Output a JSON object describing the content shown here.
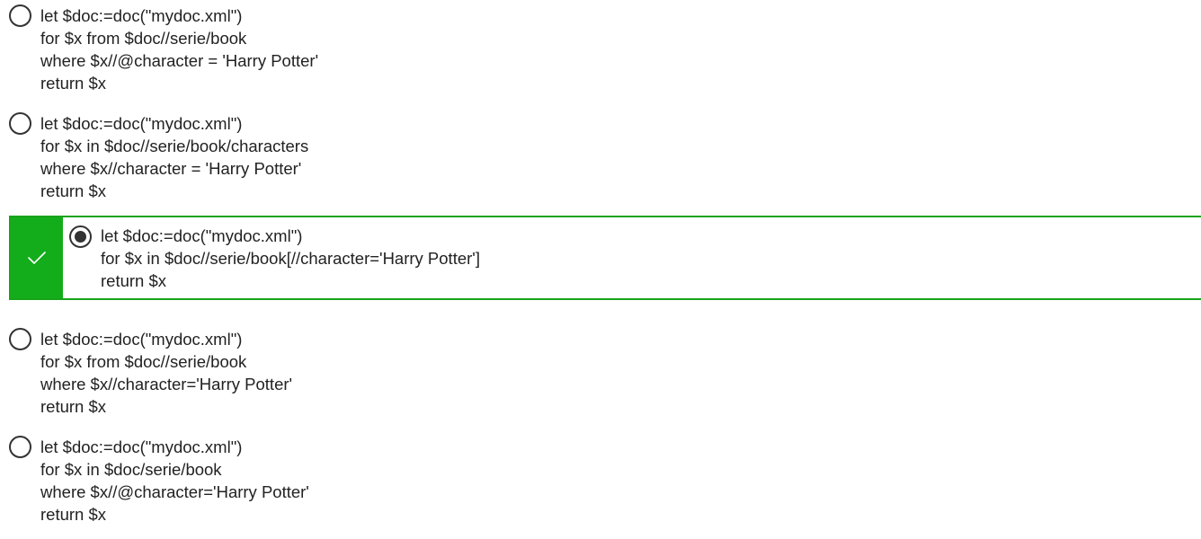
{
  "question": {
    "options": [
      {
        "lines": [
          "let $doc:=doc(\"mydoc.xml\")",
          "for $x from $doc//serie/book",
          "where $x//@character = 'Harry Potter'",
          "return $x"
        ],
        "selected": false,
        "correct": false
      },
      {
        "lines": [
          "let $doc:=doc(\"mydoc.xml\")",
          "for $x in $doc//serie/book/characters",
          "where $x//character = 'Harry Potter'",
          "return $x"
        ],
        "selected": false,
        "correct": false
      },
      {
        "lines": [
          "let $doc:=doc(\"mydoc.xml\")",
          "for $x in $doc//serie/book[//character='Harry Potter']",
          "return $x"
        ],
        "selected": true,
        "correct": true
      },
      {
        "lines": [
          "let $doc:=doc(\"mydoc.xml\")",
          "for $x from $doc//serie/book",
          "where $x//character='Harry Potter'",
          "return $x"
        ],
        "selected": false,
        "correct": false
      },
      {
        "lines": [
          "let $doc:=doc(\"mydoc.xml\")",
          "for $x in $doc/serie/book",
          "where $x//@character='Harry Potter'",
          "return $x"
        ],
        "selected": false,
        "correct": false
      }
    ]
  },
  "colors": {
    "correct_accent": "#13ad1c",
    "correct_border": "#19a319",
    "radio_border": "#333333",
    "text": "#222222"
  },
  "icons": {
    "checkmark": "check-icon"
  }
}
